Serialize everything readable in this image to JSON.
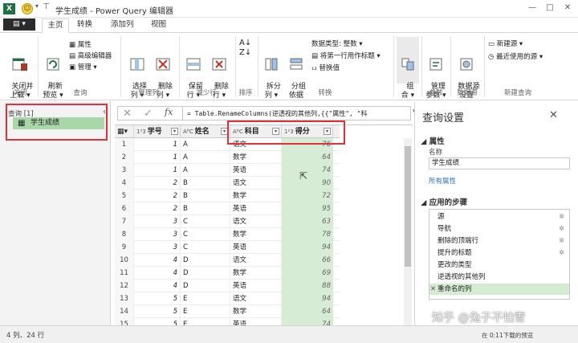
{
  "window": {
    "title": "学生成绩 - Power Query 编辑器",
    "app_icon": "X",
    "min": "—",
    "max": "□",
    "close": "✕"
  },
  "tabs": [
    {
      "label": "主页"
    },
    {
      "label": "转换"
    },
    {
      "label": "添加列"
    },
    {
      "label": "视图"
    }
  ],
  "ribbon": {
    "close_load": "关闭并\n上载 ▾",
    "refresh": "刷新\n预览 ▾",
    "properties": "属性",
    "advanced_editor": "高级编辑器",
    "manage": "管理 ▾",
    "choose_cols": "选择\n列 ▾",
    "remove_cols": "删除\n列 ▾",
    "keep_rows": "保留\n行 ▾",
    "remove_rows": "删除\n行 ▾",
    "split_col": "拆分\n列 ▾",
    "group_by": "分组\n依据",
    "data_type": "数据类型: 整数 ▾",
    "first_row_header": "将第一行用作标题 ▾",
    "replace_values": "替换值",
    "combine": "组\n合 ▾",
    "manage_params": "管理\n参数 ▾",
    "data_source_settings": "数据源\n设置",
    "new_source": "新建源 ▾",
    "recent_sources": "最近使用的源 ▾",
    "groups": {
      "close": "关闭",
      "query": "查询",
      "manage_cols": "管理列",
      "reduce_rows": "减少行",
      "sort": "排序",
      "transform": "转换",
      "params": "参数",
      "data_source": "数据源",
      "new_query": "新建查询"
    }
  },
  "queries": {
    "header": "查询 [1]",
    "items": [
      "学生成绩"
    ]
  },
  "formula": {
    "fx": "fx",
    "cancel": "✕",
    "commit": "✓",
    "text": "= Table.RenameColumns(逆透视的其他列,{{\"属性\", \"科"
  },
  "table": {
    "columns": [
      {
        "type": "1²3",
        "name": "学号"
      },
      {
        "type": "AᴮC",
        "name": "姓名"
      },
      {
        "type": "AᴮC",
        "name": "科目"
      },
      {
        "type": "1²3",
        "name": "得分"
      }
    ],
    "rows": [
      [
        "1",
        "1",
        "A",
        "语文",
        "76"
      ],
      [
        "2",
        "1",
        "A",
        "数学",
        "64"
      ],
      [
        "3",
        "1",
        "A",
        "英语",
        "74"
      ],
      [
        "4",
        "2",
        "B",
        "语文",
        "90"
      ],
      [
        "5",
        "2",
        "B",
        "数学",
        "72"
      ],
      [
        "6",
        "2",
        "B",
        "英语",
        "95"
      ],
      [
        "7",
        "3",
        "C",
        "语文",
        "63"
      ],
      [
        "8",
        "3",
        "C",
        "数学",
        "78"
      ],
      [
        "9",
        "3",
        "C",
        "英语",
        "94"
      ],
      [
        "10",
        "4",
        "D",
        "语文",
        "66"
      ],
      [
        "11",
        "4",
        "D",
        "数学",
        "69"
      ],
      [
        "12",
        "4",
        "D",
        "英语",
        "88"
      ],
      [
        "13",
        "5",
        "E",
        "语文",
        "94"
      ],
      [
        "14",
        "5",
        "E",
        "数学",
        "64"
      ],
      [
        "15",
        "5",
        "E",
        "英语",
        "74"
      ]
    ]
  },
  "settings": {
    "title": "查询设置",
    "close": "✕",
    "properties": "◢ 属性",
    "name_label": "名称",
    "name_value": "学生成绩",
    "all_props": "所有属性",
    "applied_steps": "◢ 应用的步骤",
    "steps": [
      {
        "name": "源",
        "gear": true
      },
      {
        "name": "导航",
        "gear": true
      },
      {
        "name": "删除的顶端行",
        "gear": true
      },
      {
        "name": "提升的标题",
        "gear": true
      },
      {
        "name": "更改的类型",
        "gear": false
      },
      {
        "name": "逆透视的其他列",
        "gear": false
      },
      {
        "name": "重命名的列",
        "gear": false,
        "selected": true
      }
    ]
  },
  "status": {
    "left": "4 列、24 行",
    "right": "在 0:11下载的预览"
  },
  "watermark": "知乎 @兔子不怕雪"
}
